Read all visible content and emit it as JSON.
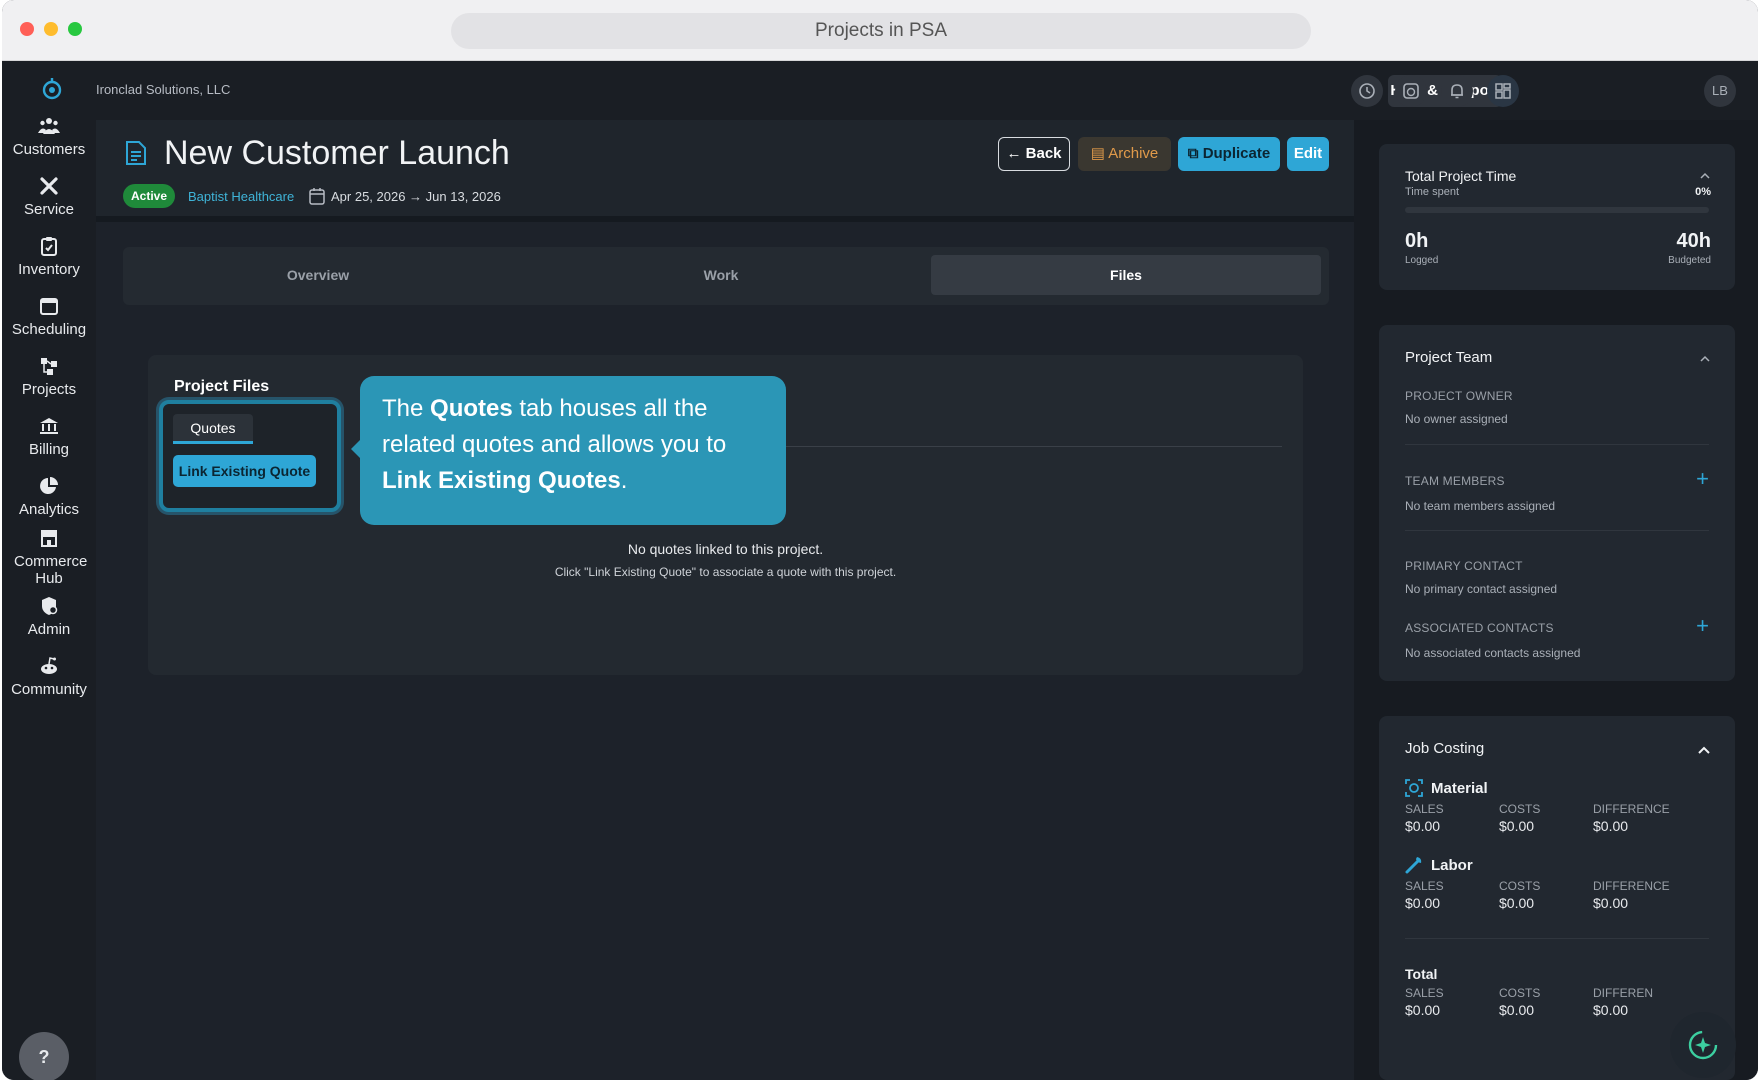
{
  "browser": {
    "title": "Projects in PSA"
  },
  "company": "Ironclad Solutions, LLC",
  "sidebar": {
    "items": [
      {
        "label": "Customers",
        "icon": "users-icon"
      },
      {
        "label": "Service",
        "icon": "tools-icon"
      },
      {
        "label": "Inventory",
        "icon": "clipboard-icon"
      },
      {
        "label": "Scheduling",
        "icon": "calendar-icon"
      },
      {
        "label": "Projects",
        "icon": "hierarchy-icon"
      },
      {
        "label": "Billing",
        "icon": "bank-icon"
      },
      {
        "label": "Analytics",
        "icon": "pie-chart-icon"
      },
      {
        "label": "Commerce Hub",
        "icon": "store-icon"
      },
      {
        "label": "Admin",
        "icon": "shield-icon"
      },
      {
        "label": "Community",
        "icon": "community-icon"
      }
    ],
    "help_label": "?"
  },
  "topbar": {
    "help_label": "Help & Support",
    "avatar_initials": "LB"
  },
  "project": {
    "title": "New Customer Launch",
    "status": "Active",
    "customer": "Baptist Healthcare",
    "date_range": "Apr 25, 2026 → Jun 13, 2026"
  },
  "actions": {
    "back": "Back",
    "archive": "Archive",
    "duplicate": "Duplicate",
    "edit": "Edit"
  },
  "tabs": [
    {
      "label": "Overview"
    },
    {
      "label": "Work"
    },
    {
      "label": "Files",
      "active": true
    }
  ],
  "files": {
    "title": "Project Files",
    "quotes_tab": "Quotes",
    "link_button": "Link Existing Quote",
    "empty_title": "No quotes linked to this project.",
    "empty_sub": "Click \"Link Existing Quote\" to associate a quote with this project."
  },
  "tooltip": {
    "p1": "The ",
    "b1": "Quotes",
    "p2": " tab houses all the related quotes and allows you to ",
    "b2": "Link Existing Quotes",
    "p3": "."
  },
  "time_card": {
    "title": "Total Project Time",
    "subtitle": "Time spent",
    "percent": "0%",
    "logged_value": "0h",
    "logged_label": "Logged",
    "budget_value": "40h",
    "budget_label": "Budgeted"
  },
  "team_card": {
    "title": "Project Team",
    "owner_label": "PROJECT OWNER",
    "owner_value": "No owner assigned",
    "members_label": "TEAM MEMBERS",
    "members_value": "No team members assigned",
    "primary_label": "PRIMARY CONTACT",
    "primary_value": "No primary contact assigned",
    "assoc_label": "ASSOCIATED CONTACTS",
    "assoc_value": "No associated contacts assigned"
  },
  "costing": {
    "title": "Job Costing",
    "col_sales": "SALES",
    "col_costs": "COSTS",
    "col_diff": "DIFFERENCE",
    "col_diff_truncated": "DIFFEREN",
    "material": {
      "label": "Material",
      "sales": "$0.00",
      "costs": "$0.00",
      "diff": "$0.00"
    },
    "labor": {
      "label": "Labor",
      "sales": "$0.00",
      "costs": "$0.00",
      "diff": "$0.00"
    },
    "total": {
      "label": "Total",
      "sales": "$0.00",
      "costs": "$0.00",
      "diff": "$0.00"
    }
  },
  "colors": {
    "accent": "#2ea6d6",
    "active": "#1f8a3a",
    "archive": "#e09a4a",
    "bg": "#1d222a"
  }
}
